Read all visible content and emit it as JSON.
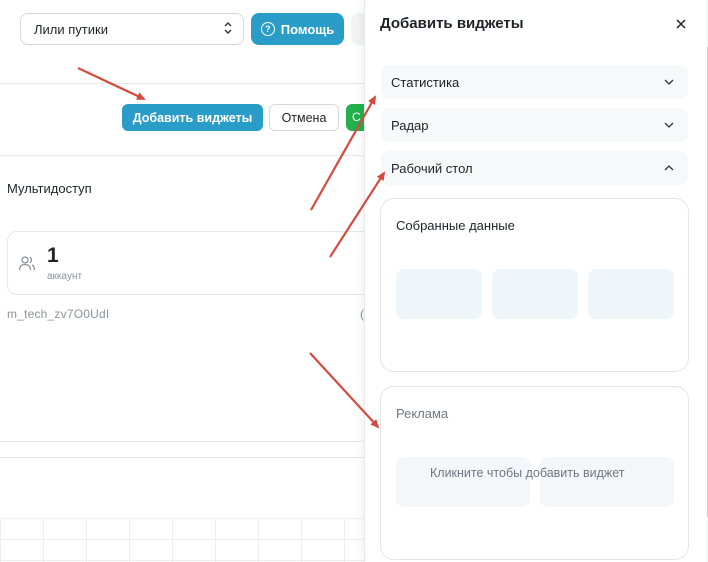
{
  "toolbar": {
    "select_value": "Лили путики",
    "help_label": "Помощь",
    "add_widgets_label": "Добавить виджеты",
    "cancel_label": "Отмена",
    "save_partial": "С"
  },
  "dashboard": {
    "card_title": "Мультидоступ",
    "stat_value": "1",
    "stat_caption": "аккаунт",
    "account_id": "m_tech_zv7O0UdI",
    "account_tail": "("
  },
  "panel": {
    "title": "Добавить виджеты",
    "sections": [
      {
        "label": "Статистика",
        "expanded": false
      },
      {
        "label": "Радар",
        "expanded": false
      },
      {
        "label": "Рабочий стол",
        "expanded": true
      }
    ],
    "widgets": [
      {
        "title": "Собранные данные"
      },
      {
        "title": "Реклама",
        "hint": "Кликните чтобы добавить виджет"
      }
    ]
  },
  "colors": {
    "accent": "#2a9cc8",
    "success": "#22b14c",
    "arrow": "#d24b3f"
  }
}
